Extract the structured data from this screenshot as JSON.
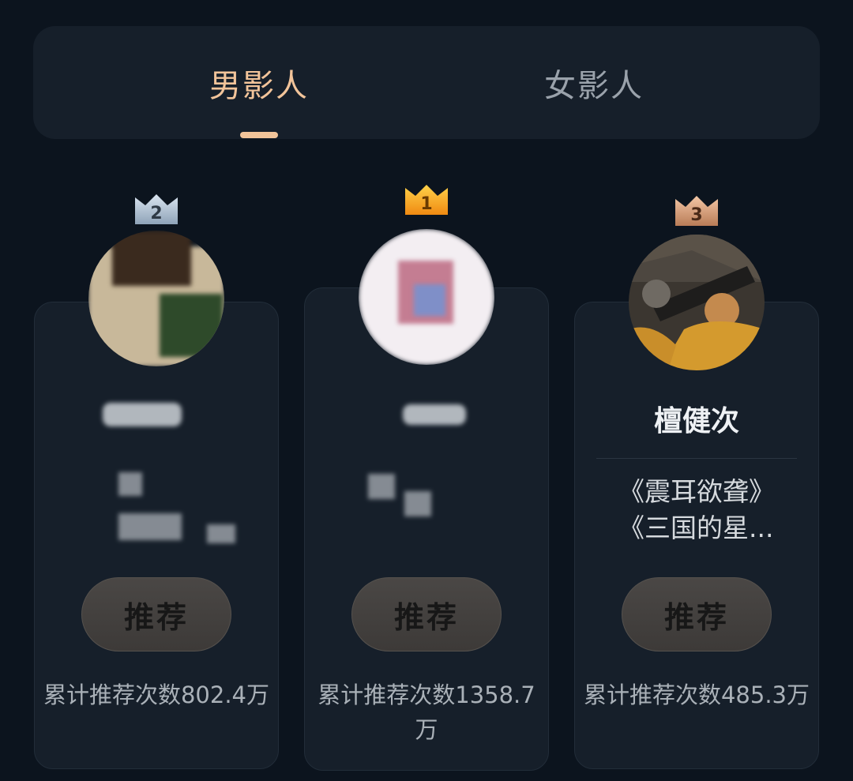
{
  "tabs": [
    {
      "label": "男影人",
      "active": true
    },
    {
      "label": "女影人",
      "active": false
    }
  ],
  "colors": {
    "accent": "#f2c49a",
    "background": "#0c141e",
    "card": "#161f2a",
    "gold": "#f5a623",
    "silver": "#b8c8d8",
    "bronze": "#d9a07a"
  },
  "cards": [
    {
      "rank": "2",
      "name": "",
      "works": [],
      "button_label": "推荐",
      "count_text": "累计推荐次数802.4万"
    },
    {
      "rank": "1",
      "name": "",
      "works": [],
      "button_label": "推荐",
      "count_text": "累计推荐次数1358.7万"
    },
    {
      "rank": "3",
      "name": "檀健次",
      "works": [
        "《震耳欲聋》",
        "《三国的星..."
      ],
      "button_label": "推荐",
      "count_text": "累计推荐次数485.3万"
    }
  ]
}
